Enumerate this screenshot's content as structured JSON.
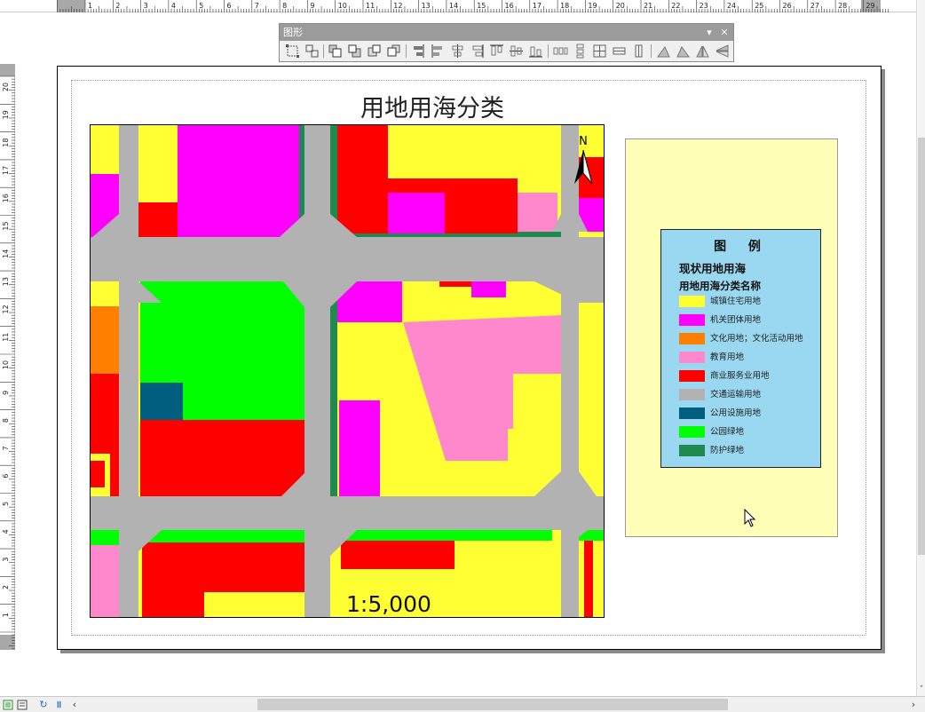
{
  "toolbar": {
    "title": "图形",
    "dropdown_icon": "chevron-down-icon",
    "close_icon": "close-icon",
    "tools": [
      "group",
      "ungroup",
      "bring-to-front",
      "send-to-back",
      "bring-forward",
      "send-backward",
      "align-left",
      "align-left-edge",
      "align-center",
      "align-right",
      "align-top",
      "align-middle",
      "align-bottom",
      "distribute-horizontal",
      "distribute-vertical",
      "grid",
      "size-width",
      "size-height",
      "rotate-left",
      "rotate-right",
      "flip-horizontal",
      "flip-vertical"
    ]
  },
  "map": {
    "title": "用地用海分类",
    "scale_text": "1:5,000",
    "north_label": "N"
  },
  "legend": {
    "title": "图 例",
    "layer_name": "现状用地用海",
    "field_name": "用地用海分类名称",
    "items": [
      {
        "label": "城镇住宅用地",
        "color": "#ffff33"
      },
      {
        "label": "机关团体用地",
        "color": "#ff00ff"
      },
      {
        "label": "文化用地；文化活动用地",
        "color": "#ff8000"
      },
      {
        "label": "教育用地",
        "color": "#ff88cc"
      },
      {
        "label": "商业服务业用地",
        "color": "#ff0000"
      },
      {
        "label": "交通运输用地",
        "color": "#b2b2b2"
      },
      {
        "label": "公用设施用地",
        "color": "#005f7f"
      },
      {
        "label": "公园绿地",
        "color": "#00ff00"
      },
      {
        "label": "防护绿地",
        "color": "#1e8a50"
      }
    ]
  },
  "rulers": {
    "top_ticks": [
      "1",
      "2",
      "3",
      "4",
      "5",
      "6",
      "7",
      "8",
      "9",
      "10",
      "11",
      "12",
      "13",
      "14",
      "15",
      "16",
      "17",
      "18",
      "19",
      "20",
      "21",
      "22",
      "23",
      "24",
      "25",
      "26",
      "27",
      "28",
      "29"
    ],
    "left_ticks": [
      "20",
      "19",
      "18",
      "17",
      "16",
      "15",
      "14",
      "13",
      "12",
      "11",
      "10",
      "9",
      "8",
      "7",
      "6",
      "5",
      "4",
      "3",
      "2",
      "1"
    ]
  },
  "status_bar": {
    "layout_view_icon": "layout-view-icon",
    "data_view_icon": "data-view-icon",
    "refresh_icon": "refresh-icon",
    "pause_icon": "pause-icon"
  }
}
